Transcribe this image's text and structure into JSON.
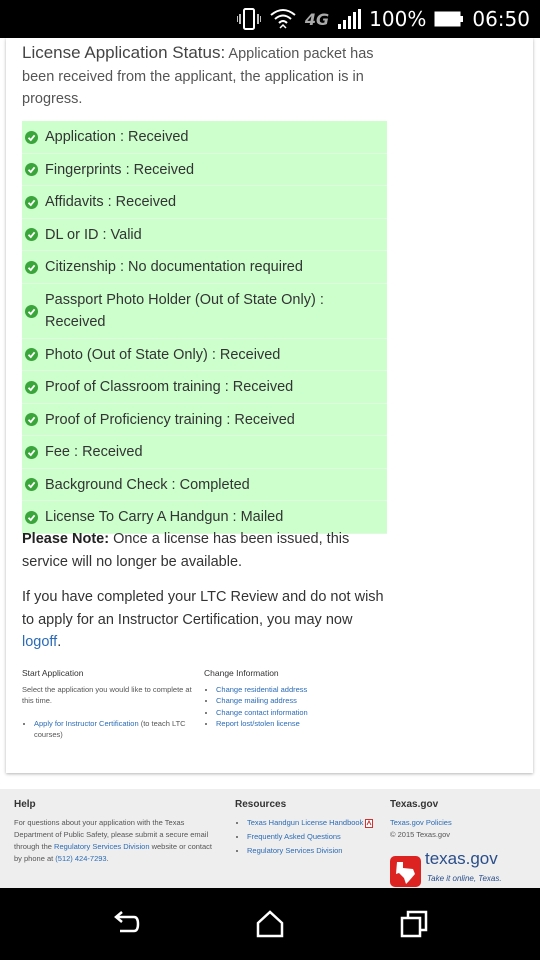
{
  "status_bar": {
    "network": "4G",
    "battery": "100%",
    "time": "06:50"
  },
  "application": {
    "status_label": "License Application Status:",
    "status_text": " Application packet has been received from the applicant, the application is in progress.",
    "items": [
      {
        "text": "Application : Received"
      },
      {
        "text": "Fingerprints : Received"
      },
      {
        "text": "Affidavits : Received"
      },
      {
        "text": "DL or ID : Valid"
      },
      {
        "text": "Citizenship : No documentation required"
      },
      {
        "text": "Passport Photo Holder (Out of State Only) : Received"
      },
      {
        "text": "Photo (Out of State Only) : Received"
      },
      {
        "text": "Proof of Classroom training : Received"
      },
      {
        "text": "Proof of Proficiency training : Received"
      },
      {
        "text": "Fee : Received"
      },
      {
        "text": "Background Check : Completed"
      },
      {
        "text": "License To Carry A Handgun : Mailed"
      }
    ],
    "note_label": "Please Note:",
    "note_text": " Once a license has been issued, this service will no longer be available.",
    "logoff_text": "If you have completed your LTC Review and do not wish to apply for an Instructor Certification, you may now ",
    "logoff_link": "logoff",
    "logoff_period": "."
  },
  "start_application": {
    "title": "Start Application",
    "description": "Select the application you would like to complete at this time.",
    "link": "Apply for Instructor Certification",
    "link_suffix": " (to teach LTC courses)"
  },
  "change_information": {
    "title": "Change Information",
    "links": [
      "Change residential address",
      "Change mailing address",
      "Change contact information",
      "Report lost/stolen license"
    ]
  },
  "footer": {
    "help": {
      "title": "Help",
      "text1": "For questions about your application with the Texas Department of Public Safety, please submit a secure email through the ",
      "link": "Regulatory Services Division",
      "text2": " website or contact by phone at ",
      "phone": "(512) 424-7293",
      "text3": "."
    },
    "resources": {
      "title": "Resources",
      "links": [
        "Texas Handgun License Handbook",
        "Frequently Asked Questions",
        "Regulatory Services Division"
      ]
    },
    "texasgov": {
      "title": "Texas.gov",
      "policies": "Texas.gov Policies",
      "copyright": "© 2015 Texas.gov",
      "logo_text": "texas.gov",
      "logo_tagline": "Take it online, Texas."
    }
  },
  "colors": {
    "status_green": "#ccffcc",
    "check_green": "#3aa53a",
    "link_blue": "#2b6bb5"
  }
}
